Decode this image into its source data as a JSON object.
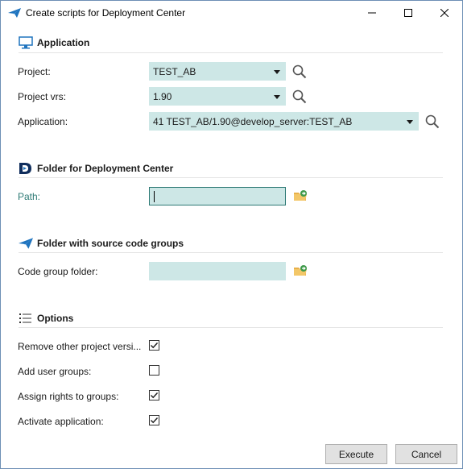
{
  "window": {
    "title": "Create scripts for Deployment Center",
    "minimize_symbol": "—",
    "maximize_symbol": "☐",
    "close_symbol": "✕"
  },
  "application_section": {
    "title": "Application",
    "icon": "monitor-icon",
    "project_label": "Project:",
    "project_value": "TEST_AB",
    "project_version_label": "Project vrs:",
    "project_version_value": "1.90",
    "application_label": "Application:",
    "application_value": "41 TEST_AB/1.90@develop_server:TEST_AB"
  },
  "deployment_folder_section": {
    "title": "Folder for Deployment Center",
    "icon": "deployment-center-logo-icon",
    "path_label": "Path:",
    "path_value": ""
  },
  "source_folder_section": {
    "title": "Folder with source code groups",
    "icon": "paper-plane-icon",
    "code_group_label": "Code group folder:",
    "code_group_value": ""
  },
  "options_section": {
    "title": "Options",
    "icon": "list-icon",
    "options": [
      {
        "label": "Remove  other  project  versi...",
        "checked": true
      },
      {
        "label": "Add user groups:",
        "checked": false
      },
      {
        "label": "Assign rights to groups:",
        "checked": true
      },
      {
        "label": "Activate application:",
        "checked": true
      }
    ]
  },
  "buttons": {
    "execute": "Execute",
    "cancel": "Cancel"
  },
  "colors": {
    "field_background": "#cde7e6",
    "accent": "#2e7a75",
    "brand_blue": "#1e73be"
  }
}
